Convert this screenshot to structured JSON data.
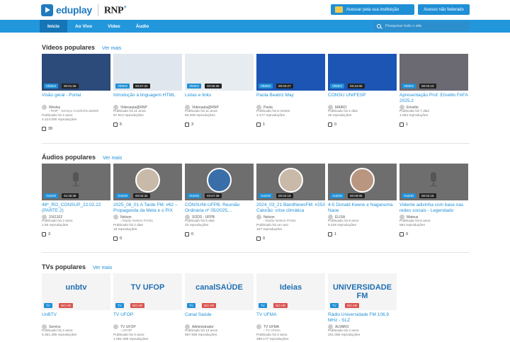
{
  "header": {
    "logo_text": "eduplay",
    "partner": "RNP",
    "btn_institution": "Acessar pela sua instituição",
    "btn_no_fed": "Acesso não federado"
  },
  "nav": {
    "items": [
      "Início",
      "Ao Vivo",
      "Vídeo",
      "Áudio"
    ],
    "search_placeholder": "Pesquisar todo o site"
  },
  "videos": {
    "title": "Vídeos populares",
    "more": "Ver mais",
    "badge": "VÍDEO",
    "items": [
      {
        "dur": "00:01:26",
        "title": "Visão geral - Portal",
        "chan": "Wesley",
        "chan2": "› RNP - Serviço ConferênciaWeb",
        "pub": "Publicado há 4 anos",
        "views": "4.424.000 reproduções",
        "likes": "30",
        "bg": "#2c4a7a"
      },
      {
        "dur": "00:57:22",
        "title": "Introdução à linguagem HTML",
        "chan": "Videoaula@RNP",
        "chan2": "",
        "pub": "Publicado há 11 anos",
        "views": "67.813 reproduções",
        "likes": "5",
        "bg": "#dfe6ee"
      },
      {
        "dur": "00:56:35",
        "title": "Listas e links",
        "chan": "Videoaula@RNP",
        "chan2": "",
        "pub": "Publicado há 11 anos",
        "views": "65.209 reproduções",
        "likes": "3",
        "bg": "#e6ecef"
      },
      {
        "dur": "00:03:27",
        "title": "Paola Beatriz May",
        "chan": "Paola",
        "chan2": "",
        "pub": "Publicado há 8 meses",
        "views": "4.177 reproduções",
        "likes": "1",
        "bg": "#1d55b4"
      },
      {
        "dur": "03:44:00",
        "title": "CONSU UNIFESP",
        "chan": "MAIRO",
        "chan2": "",
        "pub": "Publicado há 2 dias",
        "views": "26 reproduções",
        "likes": "0",
        "bg": "#1d55b4"
      },
      {
        "dur": "00:03:10",
        "title": "Apresentação Prof. Erivelto FAFA 2025.2",
        "chan": "Erivelto",
        "chan2": "",
        "pub": "Publicado há 7 dias",
        "views": "1.052 reproduções",
        "likes": "1",
        "bg": "#6b6a73"
      }
    ]
  },
  "audios": {
    "title": "Áudios populares",
    "more": "Ver mais",
    "badge": "ÁUDIO",
    "items": [
      {
        "dur": "04:35:39",
        "title": "48ª_RO_CONSUP_22.02.22 (PARTE 2)",
        "chan": "3161102",
        "chan2": "",
        "pub": "Publicado há 3 anos",
        "views": "1.50 reproduções",
        "likes": "3",
        "face": ""
      },
      {
        "dur": "00:02:32",
        "title": "2025_08_01 A Tarde FM: #62 – Propaganda da Meta e o PIX",
        "chan": "Nelson",
        "chan2": "› Rádio Nelson Pretto",
        "pub": "Publicado há 2 dias",
        "views": "19 reproduções",
        "likes": "0",
        "face": "#c9b9a8"
      },
      {
        "dur": "03:57:39",
        "title": "CONSUNI-UFPB. Reunião Ordinária nº 05/2025,...",
        "chan": "SODS - UFPB",
        "chan2": "",
        "pub": "Publicado há 9 dias",
        "views": "33 reproduções",
        "likes": "0",
        "face": "#3a6ea8"
      },
      {
        "dur": "00:02:19",
        "title": "2024_03_21 BandNewsFM: #253 Calorão: crise climática",
        "chan": "Nelson",
        "chan2": "› Rádio Nelson Pretto",
        "pub": "Publicado há um ano",
        "views": "157 reproduções",
        "likes": "0",
        "face": "#c9b9a8"
      },
      {
        "dur": "00:09:05",
        "title": "4-5 Donald Keene e Naganuma Naoe",
        "chan": "ELISA",
        "chan2": "",
        "pub": "Publicado há 8 anos",
        "views": "9.429 reproduções",
        "likes": "1",
        "face": "#b99680"
      },
      {
        "dur": "00:02:16",
        "title": "Vidente adivinha com base nas redes sociais - Legendado",
        "chan": "Mateus",
        "chan2": "",
        "pub": "Publicado há 8 anos",
        "views": "584 reproduções",
        "likes": "0",
        "face": ""
      }
    ]
  },
  "tvs": {
    "title": "TVs populares",
    "more": "Ver mais",
    "badge": "TV",
    "offline": "NO AR",
    "items": [
      {
        "title": "UnBTV",
        "logo": "unbtv",
        "chan": "Service",
        "chan2": "",
        "pub": "Publicado há 3 anos",
        "views": "6.351.286 reproduções"
      },
      {
        "title": "TV UFOP",
        "logo": "TV UFOP",
        "chan": "TV UFOP",
        "chan2": "› UFOP",
        "pub": "Publicado há 3 anos",
        "views": "1.061.069 reproduções"
      },
      {
        "title": "Canal Saúde",
        "logo": "canalSAÚDE",
        "chan": "Administrador",
        "chan2": "",
        "pub": "Publicado há 12 anos",
        "views": "867.935 reproduções"
      },
      {
        "title": "TV UFMA",
        "logo": "Ideias",
        "chan": "TV UFMA",
        "chan2": "› TV UFMA",
        "pub": "Publicado há 2 anos",
        "views": "398.177 reproduções"
      },
      {
        "title": "Rádio Universidade FM 106,9 MHz - SLZ",
        "logo": "UNIVERSIDADE FM",
        "chan": "ALVARO",
        "chan2": "",
        "pub": "Publicado há 2 anos",
        "views": "201.058 reproduções"
      }
    ]
  }
}
